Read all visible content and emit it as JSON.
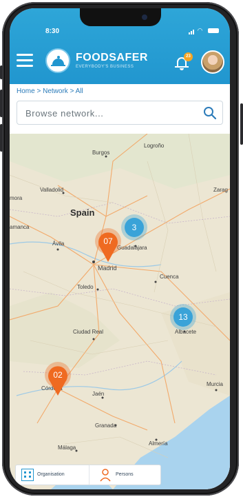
{
  "status": {
    "time": "8:30"
  },
  "header": {
    "brand": "FOODSAFER",
    "tagline": "EVERYBODY'S BUSINESS",
    "notification_count": "23",
    "icons": {
      "menu": "hamburger-icon",
      "notifications": "bell-icon",
      "profile": "avatar"
    }
  },
  "breadcrumb": {
    "items": [
      "Home",
      "Network",
      "All"
    ],
    "separator": ">"
  },
  "search": {
    "placeholder": "Browse network...",
    "value": ""
  },
  "map": {
    "country": "Spain",
    "cities": [
      "Logroño",
      "Burgos",
      "Valladolid",
      "Zarag",
      "Spain",
      "mora",
      "amanca",
      "Ávila",
      "Guadalajara",
      "Madrid",
      "Cuenca",
      "Toledo",
      "Albacete",
      "Ciudad Real",
      "Murcia",
      "Córdoba",
      "Jaén",
      "Granada",
      "Almería",
      "Málaga"
    ],
    "markers": [
      {
        "label": "3",
        "type": "cluster",
        "color": "#3aa3d8"
      },
      {
        "label": "07",
        "type": "pin",
        "color": "#ef6a21"
      },
      {
        "label": "13",
        "type": "cluster",
        "color": "#3aa3d8"
      },
      {
        "label": "02",
        "type": "pin",
        "color": "#ef6a21"
      }
    ]
  },
  "tabs": [
    {
      "label": "Organisation",
      "icon": "building-icon"
    },
    {
      "label": "Persons",
      "icon": "person-icon"
    }
  ],
  "colors": {
    "primary": "#2196cf",
    "accent": "#ef6a21",
    "badge": "#f5a524"
  }
}
